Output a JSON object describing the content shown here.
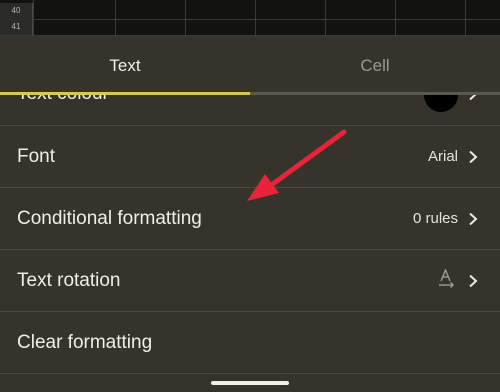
{
  "sheet": {
    "rows": [
      "40",
      "41"
    ]
  },
  "tabs": [
    {
      "label": "Text",
      "active": true
    },
    {
      "label": "Cell",
      "active": false
    }
  ],
  "items": {
    "text_colour": {
      "label": "Text colour",
      "swatch_color": "#000000"
    },
    "font": {
      "label": "Font",
      "value": "Arial"
    },
    "conditional": {
      "label": "Conditional formatting",
      "value": "0 rules"
    },
    "rotation": {
      "label": "Text rotation",
      "icon": "text-rotation-icon"
    },
    "clear": {
      "label": "Clear formatting"
    }
  },
  "colors": {
    "panel_bg": "#35332a",
    "accent": "#d8c655",
    "annotation_arrow": "#e8233a"
  }
}
